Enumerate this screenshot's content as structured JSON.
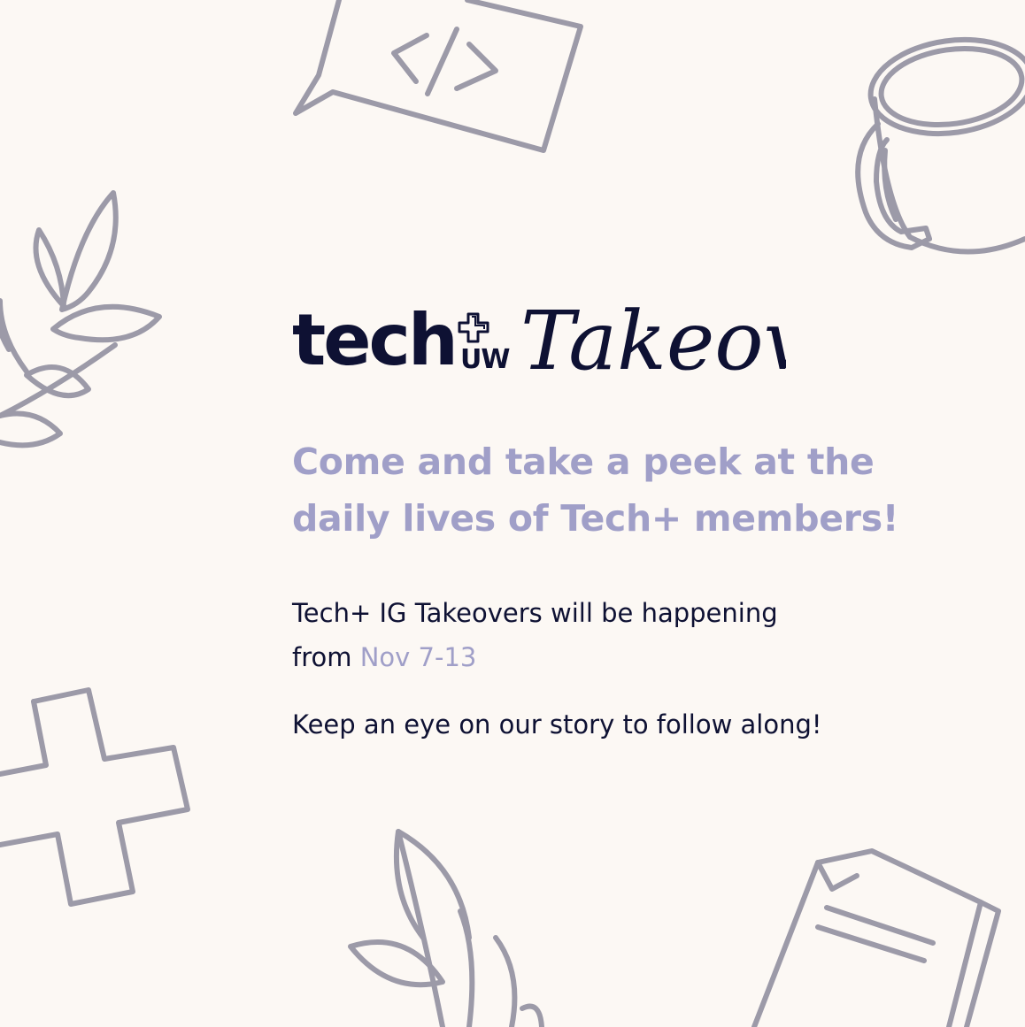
{
  "brand": {
    "wordmark": "tech",
    "sub": "UW",
    "script_title": "Takeover"
  },
  "headline": "Come and take a peek at the daily lives of Tech+ members!",
  "details": {
    "line1_prefix": "Tech+ IG Takeovers will be happening from",
    "dates": "Nov 7-13",
    "line2": "Keep an eye on our story to follow along!"
  },
  "colors": {
    "background": "#fcf8f4",
    "ink": "#0e1133",
    "accent": "#a09fc8",
    "doodle": "#9c9aa8"
  },
  "doodles": [
    "code-chat-bubble-icon",
    "mug-icon",
    "leaf-branch-icon",
    "plus-cross-icon",
    "leaf-sprig-icon",
    "document-icon"
  ]
}
